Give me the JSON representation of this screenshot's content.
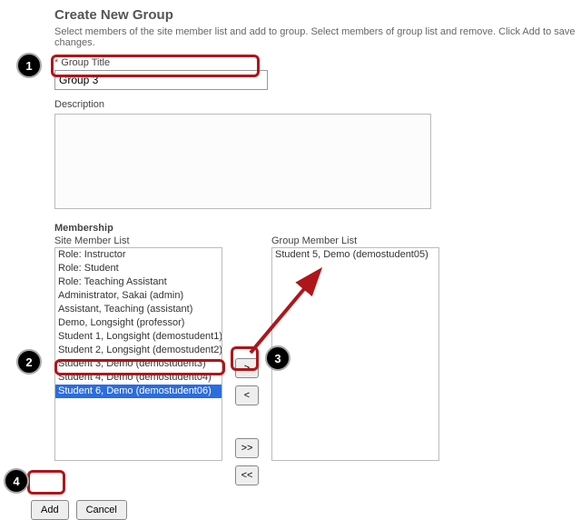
{
  "header": {
    "title": "Create New Group",
    "subtitle": "Select members of the site member list and add to group. Select members of group list and remove. Click Add to save changes."
  },
  "fields": {
    "group_title_label": "Group Title",
    "group_title_value": "Group 3",
    "description_label": "Description",
    "description_value": ""
  },
  "membership": {
    "section_label": "Membership",
    "site_list_label": "Site Member List",
    "site_items": [
      "Role: Instructor",
      "Role: Student",
      "Role: Teaching Assistant",
      "Administrator, Sakai (admin)",
      "Assistant, Teaching (assistant)",
      "Demo, Longsight (professor)",
      "Student 1, Longsight (demostudent1)",
      "Student 2, Longsight (demostudent2)",
      "Student 3, Demo (demostudent3)",
      "Student 4, Demo (demostudent04)",
      "Student 6, Demo (demostudent06)"
    ],
    "site_selected_index": 10,
    "group_list_label": "Group Member List",
    "group_items": [
      "Student 5, Demo (demostudent05)"
    ]
  },
  "move_buttons": {
    "add_one": ">",
    "remove_one": "<",
    "add_all": ">>",
    "remove_all": "<<"
  },
  "actions": {
    "add": "Add",
    "cancel": "Cancel"
  },
  "annotations": {
    "b1": "1",
    "b2": "2",
    "b3": "3",
    "b4": "4"
  }
}
